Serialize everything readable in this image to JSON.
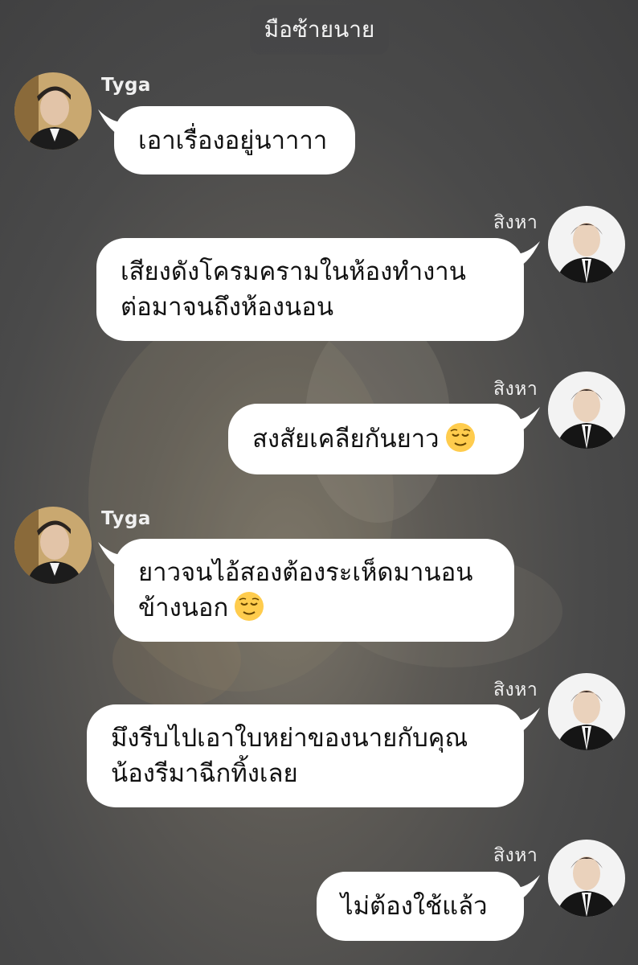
{
  "chat": {
    "title": "มือซ้ายนาย",
    "messages": [
      {
        "sender": "Tyga",
        "side": "left",
        "lines": [
          "เอาเรื่องอยู่นาาาา"
        ]
      },
      {
        "sender": "สิงหา",
        "side": "right",
        "lines": [
          "เสียงดังโครมครามในห้องทำงาน",
          "ต่อมาจนถึงห้องนอน"
        ]
      },
      {
        "sender": "สิงหา",
        "side": "right",
        "lines": [
          "สงสัยเคลียกันยาว"
        ],
        "emoji": "relieved-face"
      },
      {
        "sender": "Tyga",
        "side": "left",
        "lines": [
          "ยาวจนไอ้สองต้องระเห็ดมานอน",
          "ข้างนอก"
        ],
        "emoji": "relieved-face"
      },
      {
        "sender": "สิงหา",
        "side": "right",
        "lines": [
          "มึงรีบไปเอาใบหย่าของนายกับคุณ",
          "น้องรีมาฉีกทิ้งเลย"
        ]
      },
      {
        "sender": "สิงหา",
        "side": "right",
        "lines": [
          "ไม่ต้องใช้แล้ว"
        ]
      }
    ]
  }
}
